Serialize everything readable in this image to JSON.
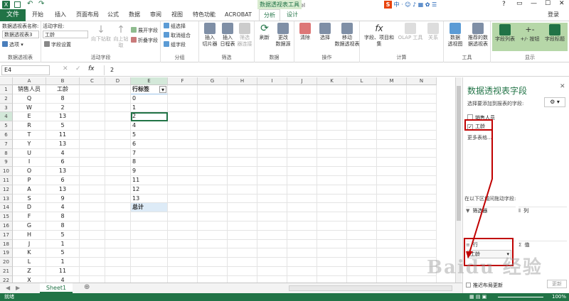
{
  "app": {
    "window_title": "工作簿1 - Excel",
    "context_tab_group": "数据透视表工具",
    "user": "登录",
    "file_tab": "文件",
    "tabs": [
      "开始",
      "插入",
      "页面布局",
      "公式",
      "数据",
      "审阅",
      "视图",
      "特色功能",
      "ACROBAT",
      "分析",
      "设计"
    ],
    "active_tab": "分析",
    "ime_label": "中",
    "window_controls": [
      "?",
      "▭",
      "—",
      "☐",
      "✕"
    ]
  },
  "ribbon": {
    "pivot_name_label": "数据透视表名称:",
    "pivot_name_value": "数据透视表3",
    "options_label": "选项",
    "group1_label": "数据透视表",
    "active_field_label": "活动字段:",
    "active_field_value": "工龄",
    "field_settings_label": "字段设置",
    "drill_down": "向下钻取",
    "drill_up": "向上钻\n取",
    "expand_field": "展开字段",
    "collapse_field": "折叠字段",
    "group2_label": "活动字段",
    "group_selection": "组选择",
    "ungroup": "取消组合",
    "group_field": "组字段",
    "group3_label": "分组",
    "insert_slicer": "插入\n切片器",
    "insert_timeline": "插入\n日程表",
    "filter_connections": "筛选\n器连接",
    "group4_label": "筛选",
    "refresh": "刷新",
    "change_source": "更改\n数据源",
    "group5_label": "数据",
    "clear": "清除",
    "select": "选择",
    "move_pivot": "移动\n数据透视表",
    "group6_label": "操作",
    "fields_items_sets": "字段、项目和\n集",
    "olap_tools": "OLAP 工具",
    "relationships": "关系",
    "group7_label": "计算",
    "pivot_chart": "数据\n透视图",
    "recommended_pivot": "推荐的数\n据透视表",
    "group8_label": "工具",
    "field_list": "字段列表",
    "plus_minus_buttons": "+/- 按钮",
    "field_headers": "字段标题",
    "group9_label": "显示"
  },
  "formula_bar": {
    "name_box": "E4",
    "fx": "fx",
    "value": "2"
  },
  "sheet": {
    "columns": [
      "A",
      "B",
      "C",
      "D",
      "E",
      "F",
      "G",
      "H",
      "I",
      "J",
      "K",
      "L",
      "M",
      "N"
    ],
    "rows": [
      "1",
      "2",
      "3",
      "4",
      "5",
      "6",
      "7",
      "8",
      "9",
      "10",
      "11",
      "12",
      "13",
      "14",
      "15",
      "16",
      "17",
      "18",
      "19",
      "20",
      "21",
      "22",
      "23"
    ],
    "col_a_header": "销售人员",
    "col_b_header": "工龄",
    "data": [
      [
        "Q",
        "8"
      ],
      [
        "W",
        "2"
      ],
      [
        "E",
        "13"
      ],
      [
        "R",
        "5"
      ],
      [
        "T",
        "11"
      ],
      [
        "Y",
        "13"
      ],
      [
        "U",
        "4"
      ],
      [
        "I",
        "6"
      ],
      [
        "O",
        "13"
      ],
      [
        "P",
        "6"
      ],
      [
        "A",
        "13"
      ],
      [
        "S",
        "9"
      ],
      [
        "D",
        "4"
      ],
      [
        "F",
        "8"
      ],
      [
        "G",
        "8"
      ],
      [
        "H",
        "5"
      ],
      [
        "J",
        "1"
      ],
      [
        "K",
        "5"
      ],
      [
        "L",
        "1"
      ],
      [
        "Z",
        "11"
      ],
      [
        "X",
        "4"
      ]
    ],
    "pivot_header": "行标签",
    "pivot_items": [
      "0",
      "1",
      "2",
      "4",
      "5",
      "6",
      "7",
      "8",
      "9",
      "11",
      "12",
      "13"
    ],
    "pivot_total": "总计",
    "sheet_tab": "Sheet1"
  },
  "panel": {
    "title": "数据透视表字段",
    "choose_label": "选择要添加到报表的字段:",
    "fields": [
      {
        "name": "销售人员",
        "checked": false
      },
      {
        "name": "工龄",
        "checked": true
      }
    ],
    "more_tables": "更多表格...",
    "drag_label": "在以下区域间拖动字段:",
    "filters_label": "筛选器",
    "columns_label": "列",
    "rows_label": "行",
    "values_label": "值",
    "row_field": "工龄",
    "defer_label": "推迟布局更新",
    "update_label": "更新"
  },
  "status": {
    "ready": "就绪",
    "zoom": "100%"
  },
  "watermark": "Baidu 经验",
  "colors": {
    "excel_green": "#217346",
    "annotation_red": "#c00000"
  }
}
